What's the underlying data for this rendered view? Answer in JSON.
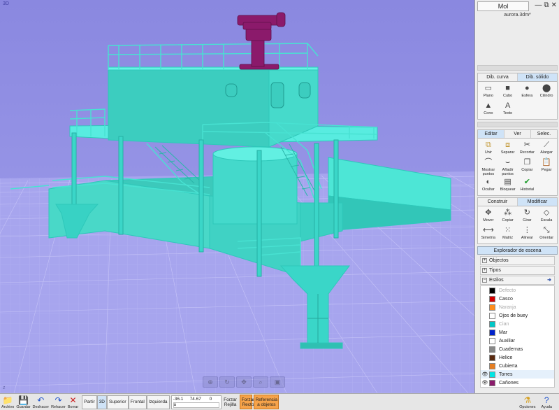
{
  "viewport": {
    "label": "3D",
    "axis": "z"
  },
  "window": {
    "title": "Mol",
    "filename": "aurora.3dm*",
    "controls": [
      "minimize-icon",
      "restore-icon",
      "close-icon"
    ]
  },
  "tabs1": [
    "Dib. curva",
    "Dib. sólido"
  ],
  "solid_tools": [
    {
      "label": "Plano",
      "icon": "plane-icon"
    },
    {
      "label": "Cubo",
      "icon": "cube-icon"
    },
    {
      "label": "Esfera",
      "icon": "sphere-icon"
    },
    {
      "label": "Cilindro",
      "icon": "cylinder-icon"
    },
    {
      "label": "Cono",
      "icon": "cone-icon"
    },
    {
      "label": "Texto",
      "icon": "text-icon"
    }
  ],
  "tabs2": [
    "Editar",
    "Ver",
    "Selec."
  ],
  "edit_tools": [
    {
      "label": "Unir",
      "icon": "join-icon"
    },
    {
      "label": "Separar",
      "icon": "separate-icon"
    },
    {
      "label": "Recortar",
      "icon": "trim-icon"
    },
    {
      "label": "Alargar",
      "icon": "extend-icon"
    },
    {
      "label": "Mostrar puntos",
      "icon": "show-points-icon"
    },
    {
      "label": "Añadir puntos",
      "icon": "add-points-icon"
    },
    {
      "label": "Copiar",
      "icon": "copy-icon"
    },
    {
      "label": "Pegar",
      "icon": "paste-icon"
    },
    {
      "label": "Ocultar",
      "icon": "hide-icon"
    },
    {
      "label": "Bloquear",
      "icon": "lock-icon"
    },
    {
      "label": "Historial",
      "icon": "history-icon"
    }
  ],
  "tabs3": [
    "Construir",
    "Modificar"
  ],
  "modify_tools": [
    {
      "label": "Mover",
      "icon": "move-icon"
    },
    {
      "label": "Copiar",
      "icon": "copy-points-icon"
    },
    {
      "label": "Girar",
      "icon": "rotate-icon"
    },
    {
      "label": "Escala",
      "icon": "scale-icon"
    },
    {
      "label": "Simetría",
      "icon": "mirror-icon"
    },
    {
      "label": "Matriz",
      "icon": "array-icon"
    },
    {
      "label": "Alinear",
      "icon": "align-icon"
    },
    {
      "label": "Orientar",
      "icon": "orient-icon"
    }
  ],
  "explorer": {
    "title": "Explorador de escena",
    "nodes": [
      {
        "label": "Objectos",
        "toggle": "+"
      },
      {
        "label": "Tipos",
        "toggle": "+"
      },
      {
        "label": "Estilos",
        "toggle": "−"
      }
    ],
    "styles": [
      {
        "name": "Defecto",
        "color": "#000000",
        "dim": true,
        "visible": false
      },
      {
        "name": "Casco",
        "color": "#d40000",
        "dim": false,
        "visible": false
      },
      {
        "name": "Naranja",
        "color": "#ff8c1a",
        "dim": true,
        "visible": false
      },
      {
        "name": "Ojos de buey",
        "color": "#ffffff",
        "dim": false,
        "visible": false
      },
      {
        "name": "Cian",
        "color": "#00c8c8",
        "dim": true,
        "visible": false
      },
      {
        "name": "Mar",
        "color": "#0022cc",
        "dim": false,
        "visible": false
      },
      {
        "name": "Auxiliar",
        "color": "#ffffff",
        "dim": false,
        "visible": false
      },
      {
        "name": "Cuadernas",
        "color": "#888888",
        "dim": false,
        "visible": false
      },
      {
        "name": "Helice",
        "color": "#5a2a10",
        "dim": false,
        "visible": false
      },
      {
        "name": "Cubierta",
        "color": "#e67e22",
        "dim": false,
        "visible": false
      },
      {
        "name": "Torres",
        "color": "#00e5e5",
        "dim": false,
        "visible": true,
        "selected": true
      },
      {
        "name": "Cañones",
        "color": "#8b1a6b",
        "dim": false,
        "visible": true
      }
    ]
  },
  "toolbar": {
    "file": [
      {
        "label": "Archivo",
        "icon": "folder-icon"
      },
      {
        "label": "Guardar",
        "icon": "save-icon"
      },
      {
        "label": "Deshacer",
        "icon": "undo-icon"
      },
      {
        "label": "Rehacer",
        "icon": "redo-icon"
      },
      {
        "label": "Borrar",
        "icon": "delete-icon"
      }
    ],
    "views": [
      "Partir",
      "3D",
      "Superior",
      "Frontal",
      "Izquierda"
    ],
    "active_view": "3D",
    "coords": {
      "x": "-36.1",
      "y": "74.67",
      "z": "0",
      "input_label": "a"
    },
    "forzar_rejilla": "Forzar Rejilla",
    "forzar_recto": "Forzar Recto",
    "referencia": "Referencia a objetos",
    "right": [
      {
        "label": "Opciones",
        "icon": "options-icon"
      },
      {
        "label": "Ayuda",
        "icon": "help-icon"
      }
    ]
  },
  "colors": {
    "background": "#9a98e6",
    "grid": "#c4c2f6",
    "model": "#36e0d0",
    "cannon": "#8b1a6b"
  }
}
